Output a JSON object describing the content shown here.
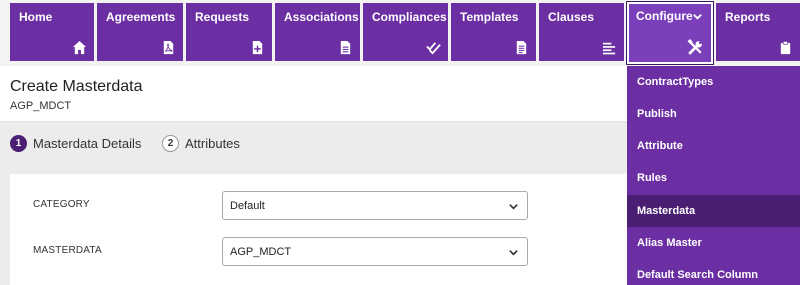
{
  "nav": {
    "tiles": [
      {
        "label": "Home",
        "icon": "home-icon"
      },
      {
        "label": "Agreements",
        "icon": "pdf-file-icon"
      },
      {
        "label": "Requests",
        "icon": "add-file-icon"
      },
      {
        "label": "Associations",
        "icon": "document-icon"
      },
      {
        "label": "Compliances",
        "icon": "double-check-icon"
      },
      {
        "label": "Templates",
        "icon": "document-lines-icon"
      },
      {
        "label": "Clauses",
        "icon": "align-left-icon"
      },
      {
        "label": "Configure",
        "icon": "tools-icon"
      },
      {
        "label": "Reports",
        "icon": "clipboard-icon"
      }
    ],
    "active": "Configure"
  },
  "page": {
    "title": "Create Masterdata",
    "subtitle": "AGP_MDCT"
  },
  "steps": [
    {
      "number": "1",
      "label": "Masterdata Details",
      "active": true
    },
    {
      "number": "2",
      "label": "Attributes",
      "active": false
    }
  ],
  "form": {
    "category_label": "CATEGORY",
    "category_value": "Default",
    "masterdata_label": "MASTERDATA",
    "masterdata_value": "AGP_MDCT"
  },
  "configure_menu": {
    "items": [
      "ContractTypes",
      "Publish",
      "Attribute",
      "Rules",
      "Masterdata",
      "Alias Master",
      "Default Search Column"
    ],
    "selected": "Masterdata"
  },
  "colors": {
    "nav_purple": "#6b2fa3",
    "selected_purple": "#4a1f73",
    "background": "#ececec"
  }
}
